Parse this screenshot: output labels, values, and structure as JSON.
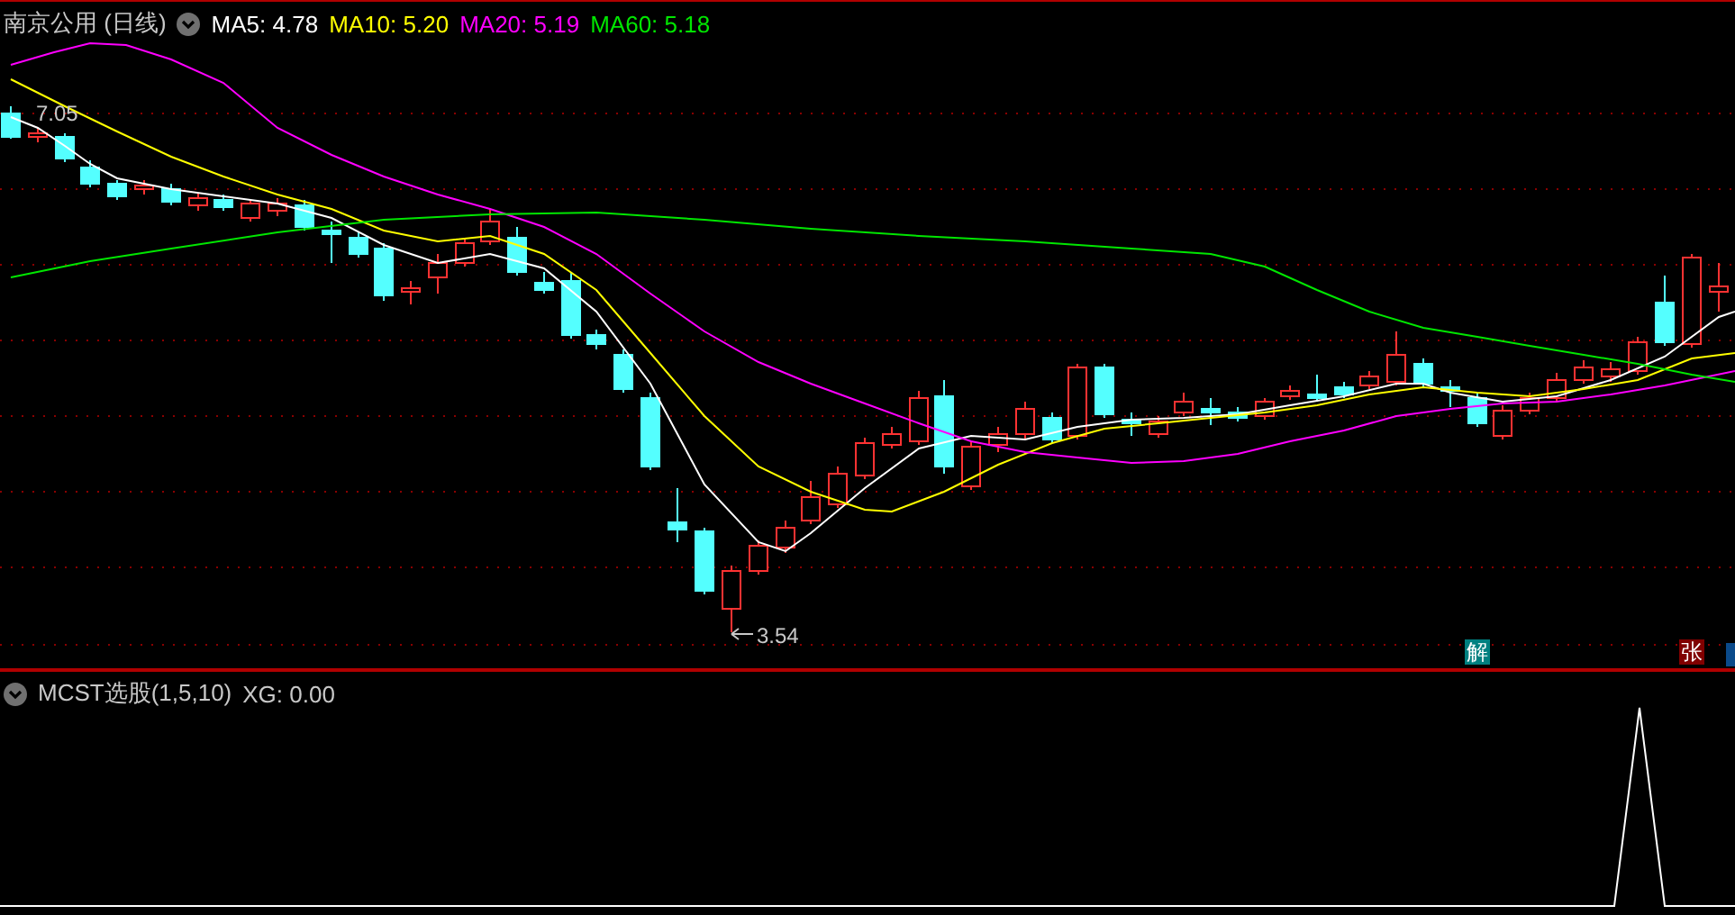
{
  "price_panel": {
    "title": "南京公用 (日线)",
    "ma_legend": [
      {
        "label": "MA5:",
        "value": "4.78",
        "color": "#ffffff"
      },
      {
        "label": "MA10:",
        "value": "5.20",
        "color": "#ffff00"
      },
      {
        "label": "MA20:",
        "value": "5.19",
        "color": "#ff00ff"
      },
      {
        "label": "MA60:",
        "value": "5.18",
        "color": "#00e600"
      }
    ],
    "high_label": "7.05",
    "low_label": "3.54",
    "markers": [
      {
        "text": "解",
        "color": "#008080"
      },
      {
        "text": "张",
        "color": "#800000"
      }
    ]
  },
  "indicator_panel": {
    "title": "MCST选股(1,5,10)",
    "readout": "XG: 0.00"
  }
}
